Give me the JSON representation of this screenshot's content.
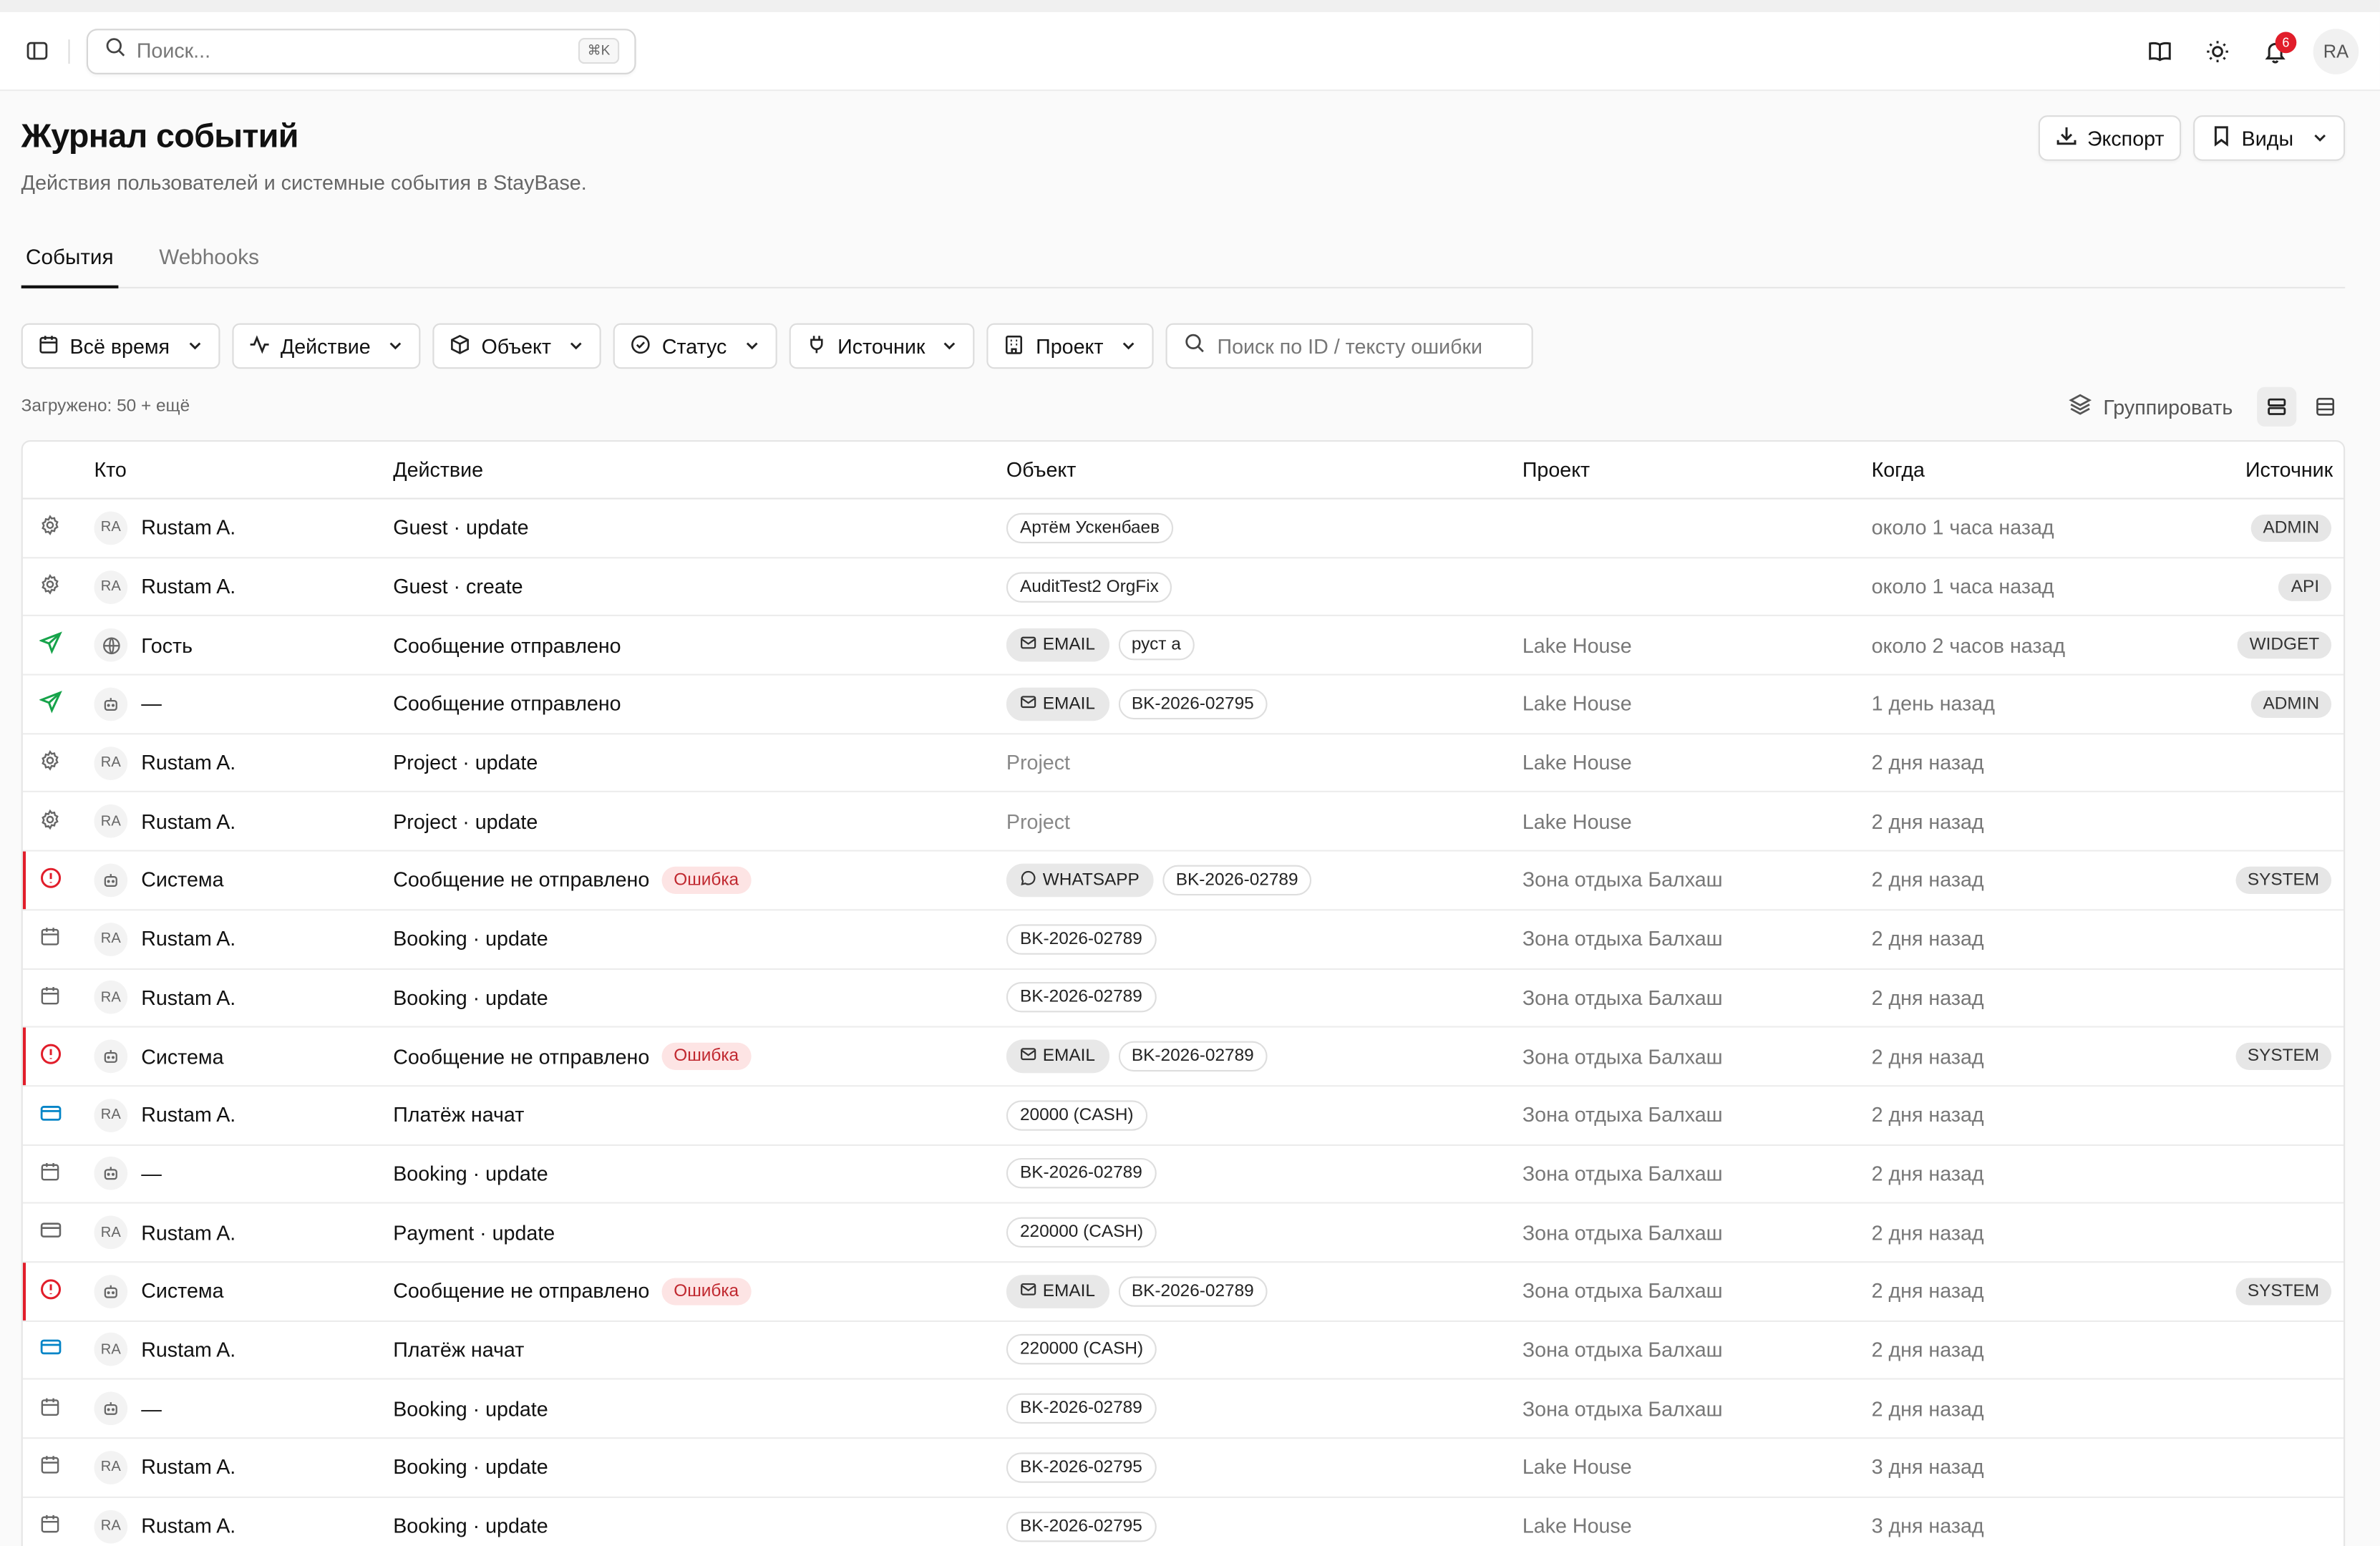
{
  "topbar": {
    "search_placeholder": "Поиск...",
    "search_shortcut": "⌘K",
    "notif_count": "6",
    "avatar": "RA"
  },
  "page": {
    "title": "Журнал событий",
    "subtitle": "Действия пользователей и системные события в StayBase.",
    "export_label": "Экспорт",
    "views_label": "Виды"
  },
  "tabs": [
    {
      "label": "События"
    },
    {
      "label": "Webhooks"
    }
  ],
  "filters": {
    "time": "Всё время",
    "action": "Действие",
    "object": "Объект",
    "status": "Статус",
    "source": "Источник",
    "project": "Проект",
    "search_placeholder": "Поиск по ID / тексту ошибки"
  },
  "meta": {
    "loaded": "Загружено: 50 + ещё",
    "group": "Группировать"
  },
  "columns": {
    "who": "Кто",
    "action": "Действие",
    "object": "Объект",
    "project": "Проект",
    "when": "Когда",
    "source": "Источник"
  },
  "colors": {
    "error": "#e11d2a",
    "success_icon": "#16a34a",
    "payment_icon": "#0284c7"
  },
  "rows": [
    {
      "icon": "gear-icon",
      "avatar": "RA",
      "who": "Rustam A.",
      "action": "Guest · update",
      "error_label": "",
      "channel": "",
      "object": "Артём Ускенбаев",
      "object_plain": "",
      "project": "",
      "when": "около 1 часа назад",
      "source": "ADMIN"
    },
    {
      "icon": "gear-icon",
      "avatar": "RA",
      "who": "Rustam A.",
      "action": "Guest · create",
      "error_label": "",
      "channel": "",
      "object": "AuditTest2 OrgFix",
      "object_plain": "",
      "project": "",
      "when": "около 1 часа назад",
      "source": "API"
    },
    {
      "icon": "send-icon",
      "avatar": "globe",
      "who": "Гость",
      "action": "Сообщение отправлено",
      "error_label": "",
      "channel": "EMAIL",
      "object": "руст а",
      "object_plain": "",
      "project": "Lake House",
      "when": "около 2 часов назад",
      "source": "WIDGET"
    },
    {
      "icon": "send-icon",
      "avatar": "bot",
      "who": "—",
      "action": "Сообщение отправлено",
      "error_label": "",
      "channel": "EMAIL",
      "object": "BK-2026-02795",
      "object_plain": "",
      "project": "Lake House",
      "when": "1 день назад",
      "source": "ADMIN"
    },
    {
      "icon": "gear-icon",
      "avatar": "RA",
      "who": "Rustam A.",
      "action": "Project · update",
      "error_label": "",
      "channel": "",
      "object": "",
      "object_plain": "Project",
      "project": "Lake House",
      "when": "2 дня назад",
      "source": ""
    },
    {
      "icon": "gear-icon",
      "avatar": "RA",
      "who": "Rustam A.",
      "action": "Project · update",
      "error_label": "",
      "channel": "",
      "object": "",
      "object_plain": "Project",
      "project": "Lake House",
      "when": "2 дня назад",
      "source": ""
    },
    {
      "icon": "alert-icon",
      "avatar": "bot",
      "who": "Система",
      "action": "Сообщение не отправлено",
      "error_label": "Ошибка",
      "channel": "WHATSAPP",
      "object": "BK-2026-02789",
      "object_plain": "",
      "project": "Зона отдыха Балхаш",
      "when": "2 дня назад",
      "source": "SYSTEM"
    },
    {
      "icon": "calendar-icon",
      "avatar": "RA",
      "who": "Rustam A.",
      "action": "Booking · update",
      "error_label": "",
      "channel": "",
      "object": "BK-2026-02789",
      "object_plain": "",
      "project": "Зона отдыха Балхаш",
      "when": "2 дня назад",
      "source": ""
    },
    {
      "icon": "calendar-icon",
      "avatar": "RA",
      "who": "Rustam A.",
      "action": "Booking · update",
      "error_label": "",
      "channel": "",
      "object": "BK-2026-02789",
      "object_plain": "",
      "project": "Зона отдыха Балхаш",
      "when": "2 дня назад",
      "source": ""
    },
    {
      "icon": "alert-icon",
      "avatar": "bot",
      "who": "Система",
      "action": "Сообщение не отправлено",
      "error_label": "Ошибка",
      "channel": "EMAIL",
      "object": "BK-2026-02789",
      "object_plain": "",
      "project": "Зона отдыха Балхаш",
      "when": "2 дня назад",
      "source": "SYSTEM"
    },
    {
      "icon": "card-blue-icon",
      "avatar": "RA",
      "who": "Rustam A.",
      "action": "Платёж начат",
      "error_label": "",
      "channel": "",
      "object": "20000 (CASH)",
      "object_plain": "",
      "project": "Зона отдыха Балхаш",
      "when": "2 дня назад",
      "source": ""
    },
    {
      "icon": "calendar-icon",
      "avatar": "bot",
      "who": "—",
      "action": "Booking · update",
      "error_label": "",
      "channel": "",
      "object": "BK-2026-02789",
      "object_plain": "",
      "project": "Зона отдыха Балхаш",
      "when": "2 дня назад",
      "source": ""
    },
    {
      "icon": "card-icon",
      "avatar": "RA",
      "who": "Rustam A.",
      "action": "Payment · update",
      "error_label": "",
      "channel": "",
      "object": "220000 (CASH)",
      "object_plain": "",
      "project": "Зона отдыха Балхаш",
      "when": "2 дня назад",
      "source": ""
    },
    {
      "icon": "alert-icon",
      "avatar": "bot",
      "who": "Система",
      "action": "Сообщение не отправлено",
      "error_label": "Ошибка",
      "channel": "EMAIL",
      "object": "BK-2026-02789",
      "object_plain": "",
      "project": "Зона отдыха Балхаш",
      "when": "2 дня назад",
      "source": "SYSTEM"
    },
    {
      "icon": "card-blue-icon",
      "avatar": "RA",
      "who": "Rustam A.",
      "action": "Платёж начат",
      "error_label": "",
      "channel": "",
      "object": "220000 (CASH)",
      "object_plain": "",
      "project": "Зона отдыха Балхаш",
      "when": "2 дня назад",
      "source": ""
    },
    {
      "icon": "calendar-icon",
      "avatar": "bot",
      "who": "—",
      "action": "Booking · update",
      "error_label": "",
      "channel": "",
      "object": "BK-2026-02789",
      "object_plain": "",
      "project": "Зона отдыха Балхаш",
      "when": "2 дня назад",
      "source": ""
    },
    {
      "icon": "calendar-icon",
      "avatar": "RA",
      "who": "Rustam A.",
      "action": "Booking · update",
      "error_label": "",
      "channel": "",
      "object": "BK-2026-02795",
      "object_plain": "",
      "project": "Lake House",
      "when": "3 дня назад",
      "source": ""
    },
    {
      "icon": "calendar-icon",
      "avatar": "RA",
      "who": "Rustam A.",
      "action": "Booking · update",
      "error_label": "",
      "channel": "",
      "object": "BK-2026-02795",
      "object_plain": "",
      "project": "Lake House",
      "when": "3 дня назад",
      "source": ""
    }
  ]
}
